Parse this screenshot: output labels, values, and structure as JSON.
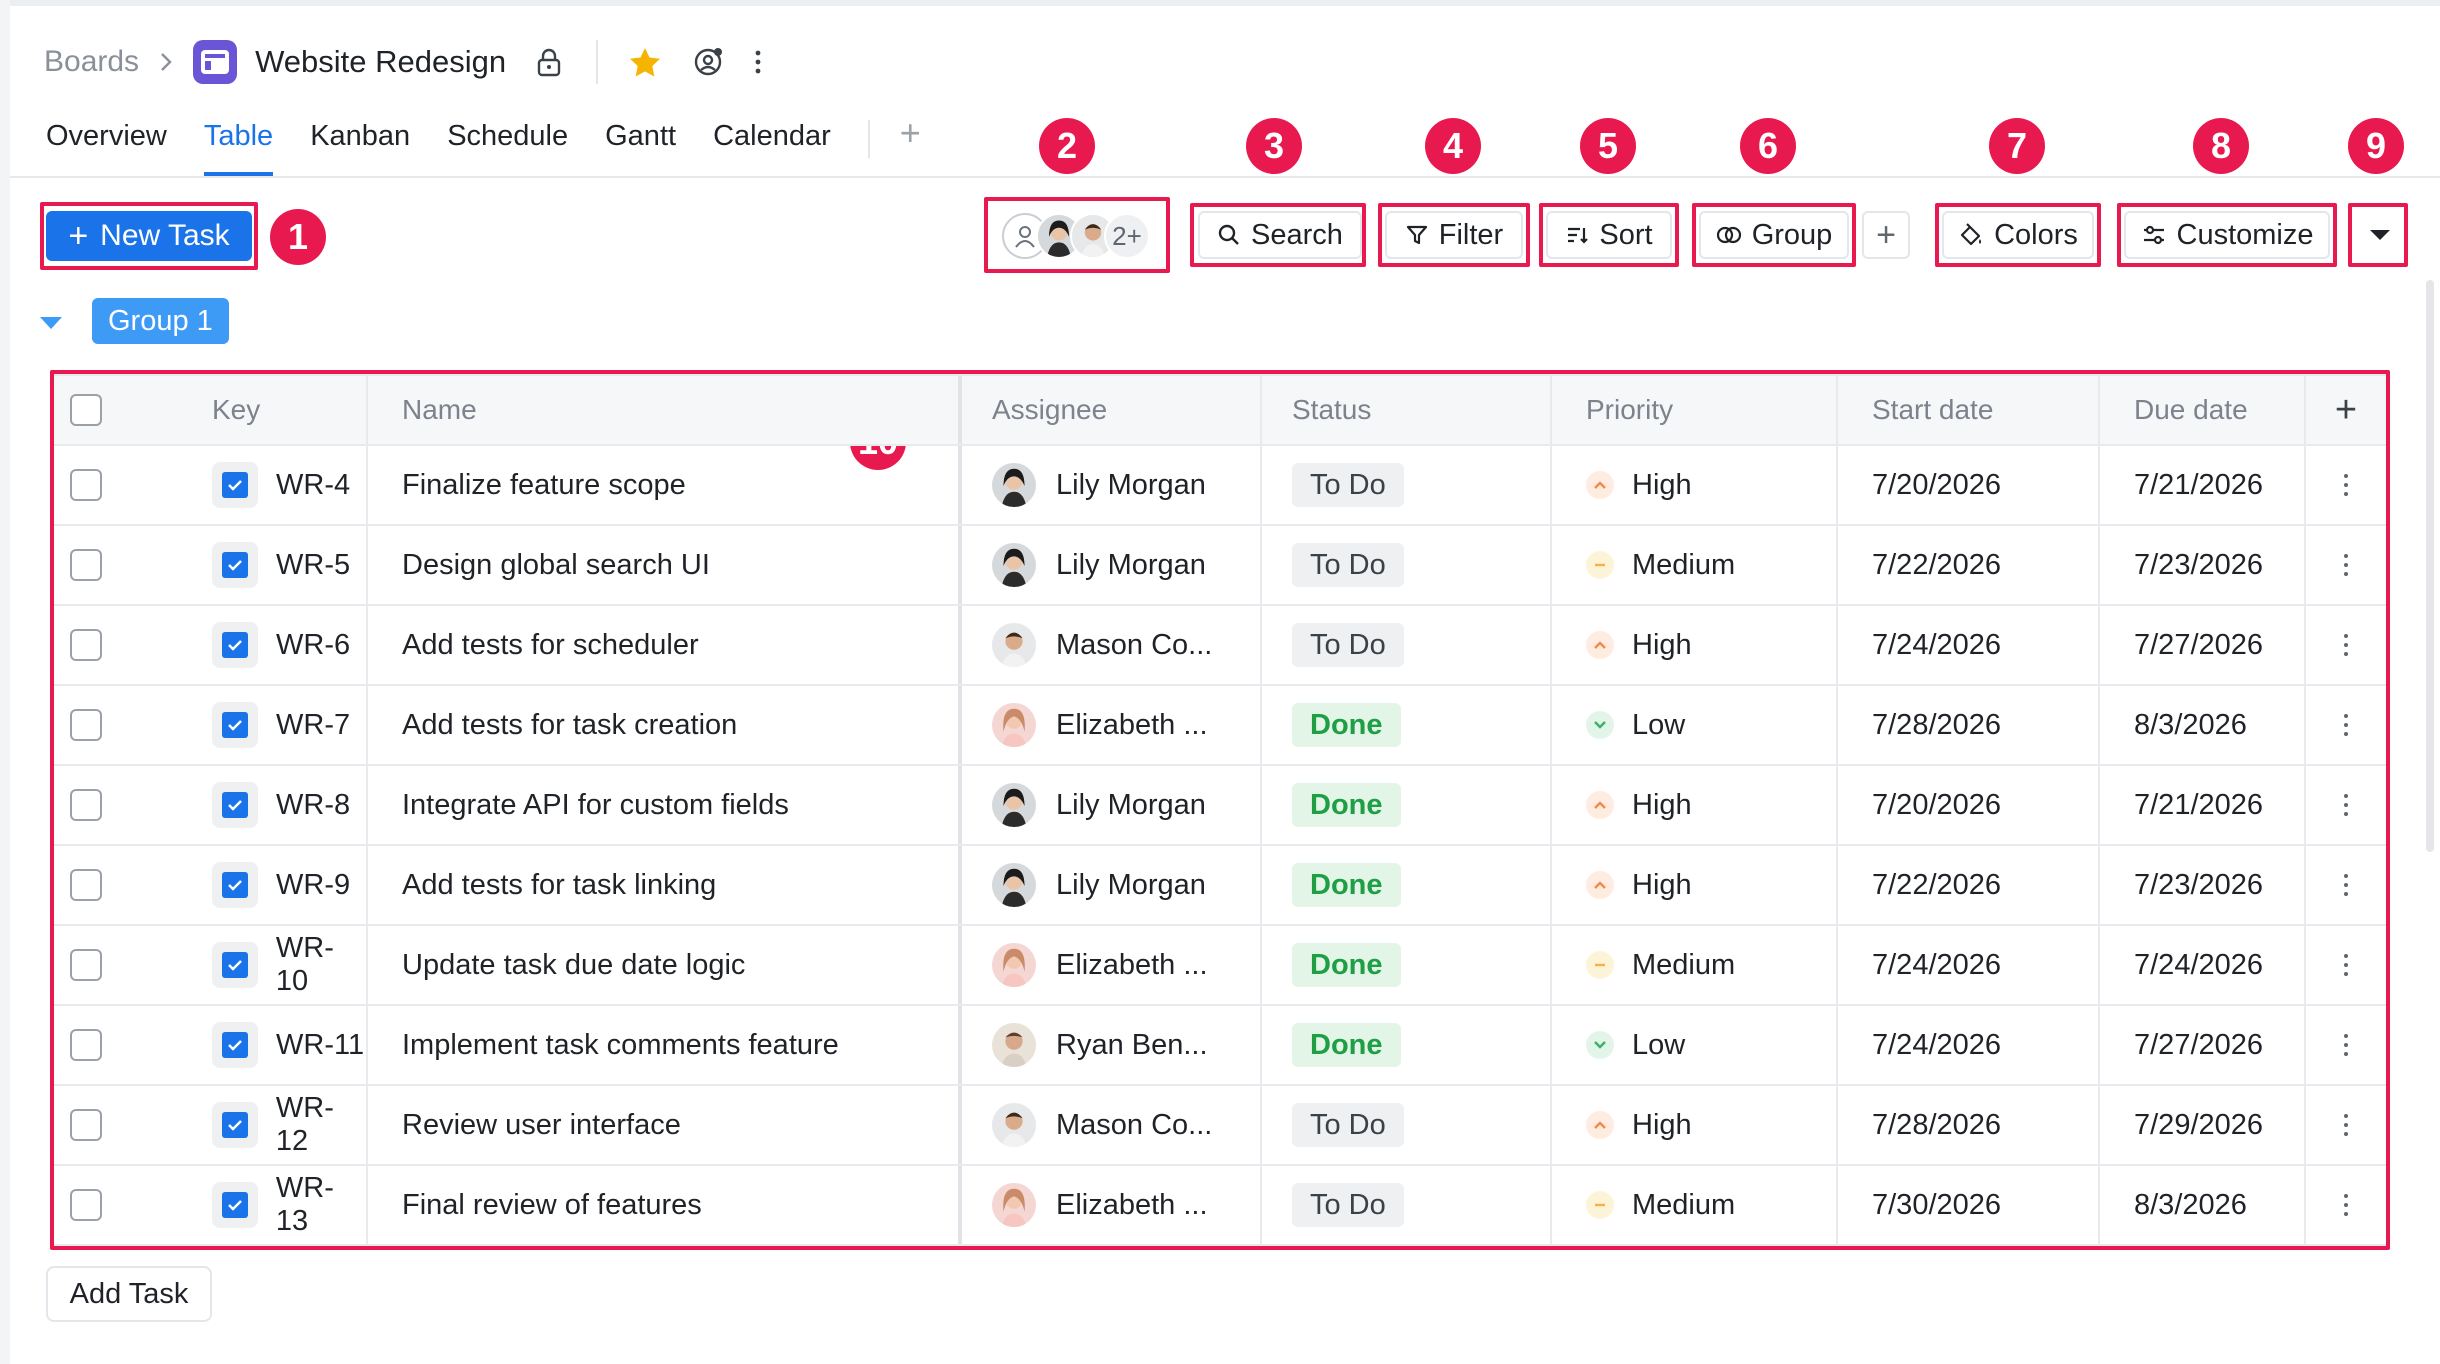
{
  "breadcrumb": {
    "root": "Boards",
    "board_title": "Website Redesign"
  },
  "tabs": [
    {
      "label": "Overview",
      "active": false
    },
    {
      "label": "Table",
      "active": true
    },
    {
      "label": "Kanban",
      "active": false
    },
    {
      "label": "Schedule",
      "active": false
    },
    {
      "label": "Gantt",
      "active": false
    },
    {
      "label": "Calendar",
      "active": false
    }
  ],
  "toolbar": {
    "new_task_label": "New Task",
    "avatars_more": "2+",
    "search_label": "Search",
    "filter_label": "Filter",
    "sort_label": "Sort",
    "group_label": "Group",
    "colors_label": "Colors",
    "customize_label": "Customize"
  },
  "callouts": [
    "1",
    "2",
    "3",
    "4",
    "5",
    "6",
    "7",
    "8",
    "9",
    "10"
  ],
  "group": {
    "label": "Group 1"
  },
  "table": {
    "columns": [
      "Key",
      "Name",
      "Assignee",
      "Status",
      "Priority",
      "Start date",
      "Due date"
    ],
    "rows": [
      {
        "key": "WR-4",
        "name": "Finalize feature scope",
        "assignee": "Lily Morgan",
        "avatar": "lily",
        "status": "To Do",
        "priority": "High",
        "start": "7/20/2026",
        "due": "7/21/2026"
      },
      {
        "key": "WR-5",
        "name": "Design global search UI",
        "assignee": "Lily Morgan",
        "avatar": "lily",
        "status": "To Do",
        "priority": "Medium",
        "start": "7/22/2026",
        "due": "7/23/2026"
      },
      {
        "key": "WR-6",
        "name": "Add tests for scheduler",
        "assignee": "Mason Co...",
        "avatar": "mason",
        "status": "To Do",
        "priority": "High",
        "start": "7/24/2026",
        "due": "7/27/2026"
      },
      {
        "key": "WR-7",
        "name": "Add tests for task creation",
        "assignee": "Elizabeth ...",
        "avatar": "elizabeth",
        "status": "Done",
        "priority": "Low",
        "start": "7/28/2026",
        "due": "8/3/2026"
      },
      {
        "key": "WR-8",
        "name": "Integrate API for custom fields",
        "assignee": "Lily Morgan",
        "avatar": "lily",
        "status": "Done",
        "priority": "High",
        "start": "7/20/2026",
        "due": "7/21/2026"
      },
      {
        "key": "WR-9",
        "name": "Add tests for task linking",
        "assignee": "Lily Morgan",
        "avatar": "lily",
        "status": "Done",
        "priority": "High",
        "start": "7/22/2026",
        "due": "7/23/2026"
      },
      {
        "key": "WR-10",
        "name": "Update task due date logic",
        "assignee": "Elizabeth ...",
        "avatar": "elizabeth",
        "status": "Done",
        "priority": "Medium",
        "start": "7/24/2026",
        "due": "7/24/2026"
      },
      {
        "key": "WR-11",
        "name": "Implement task comments feature",
        "assignee": "Ryan Ben...",
        "avatar": "ryan",
        "status": "Done",
        "priority": "Low",
        "start": "7/24/2026",
        "due": "7/27/2026"
      },
      {
        "key": "WR-12",
        "name": "Review user interface",
        "assignee": "Mason Co...",
        "avatar": "mason",
        "status": "To Do",
        "priority": "High",
        "start": "7/28/2026",
        "due": "7/29/2026"
      },
      {
        "key": "WR-13",
        "name": "Final review of features",
        "assignee": "Elizabeth ...",
        "avatar": "elizabeth",
        "status": "To Do",
        "priority": "Medium",
        "start": "7/30/2026",
        "due": "8/3/2026"
      }
    ]
  },
  "add_task_label": "Add Task",
  "colors": {
    "accent": "#1a73e8",
    "callout": "#e8194f",
    "group_badge": "#3d9af5",
    "board_icon": "#6a55d6",
    "done_text": "#1e9e45"
  }
}
